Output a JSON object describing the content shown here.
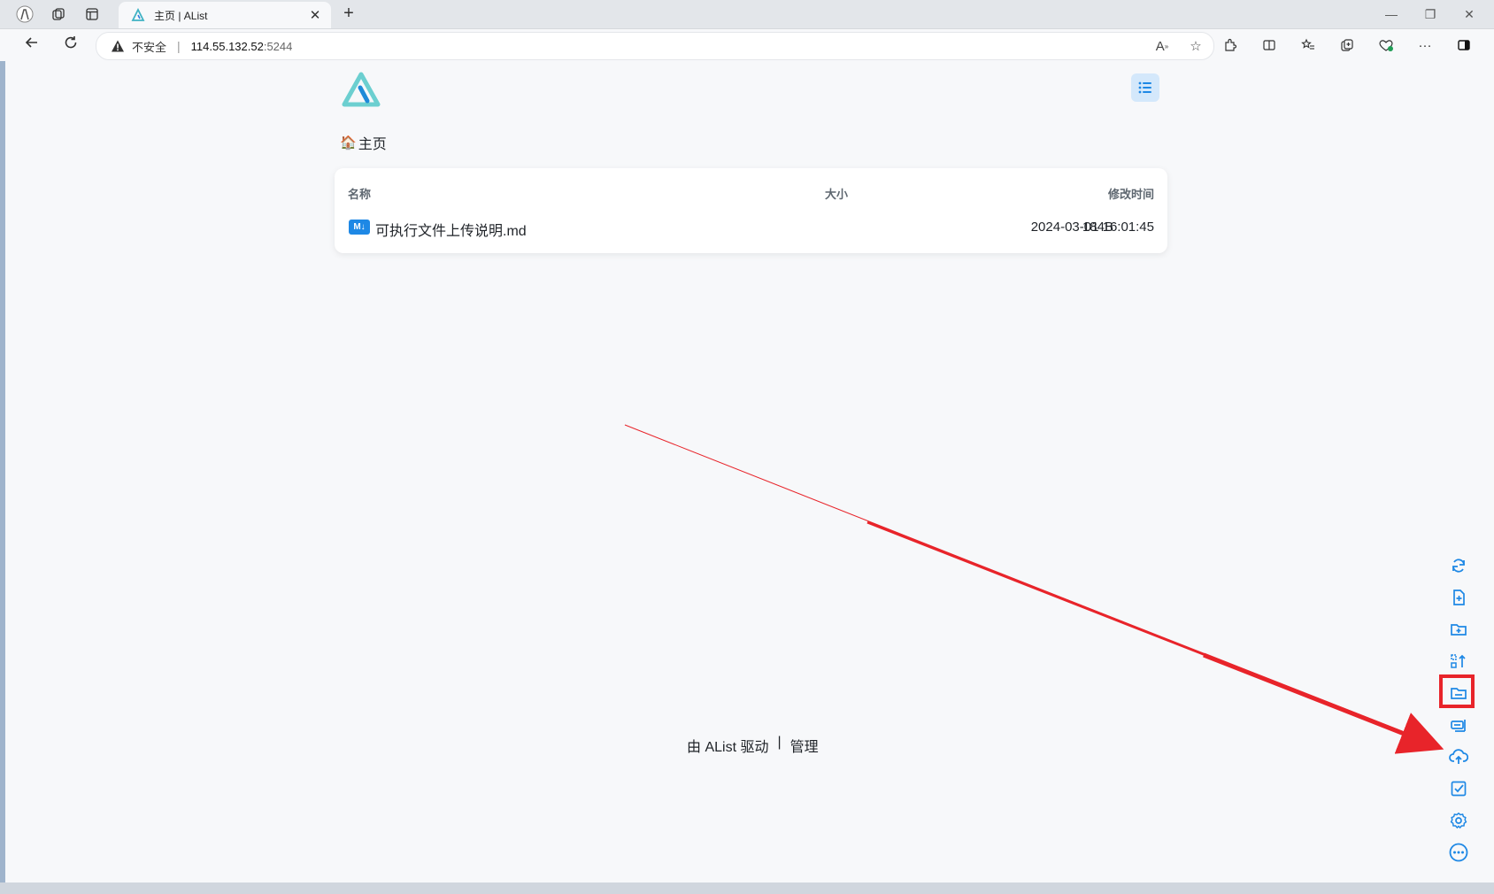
{
  "browser": {
    "tab_title": "主页 | AList",
    "new_tab": "+",
    "address": {
      "security_label": "不安全",
      "host": "114.55.132.52",
      "port": ":5244"
    },
    "window_controls": {
      "minimize": "—",
      "restore": "❐",
      "close": "✕"
    }
  },
  "app": {
    "breadcrumb": {
      "home_label": "主页"
    },
    "file_list": {
      "headers": {
        "name": "名称",
        "size": "大小",
        "modified": "修改时间"
      },
      "rows": [
        {
          "icon_label": "M↓",
          "name": "可执行文件上传说明.md",
          "size": "184B",
          "modified": "2024-03-01 16:01:45"
        }
      ]
    },
    "footer": {
      "powered_by": "由 AList 驱动",
      "divider": "|",
      "manage": "管理"
    },
    "side_toolbar": {
      "buttons": [
        "refresh-icon",
        "new-file-icon",
        "new-folder-icon",
        "sort-upload-icon",
        "folder-icon",
        "offline-download-icon",
        "upload-icon",
        "check-icon",
        "settings-icon",
        "more-icon"
      ],
      "highlighted": "upload-icon"
    }
  },
  "colors": {
    "accent": "#1e88e5",
    "annotation": "#e8242a",
    "background": "#f7f8fa"
  }
}
